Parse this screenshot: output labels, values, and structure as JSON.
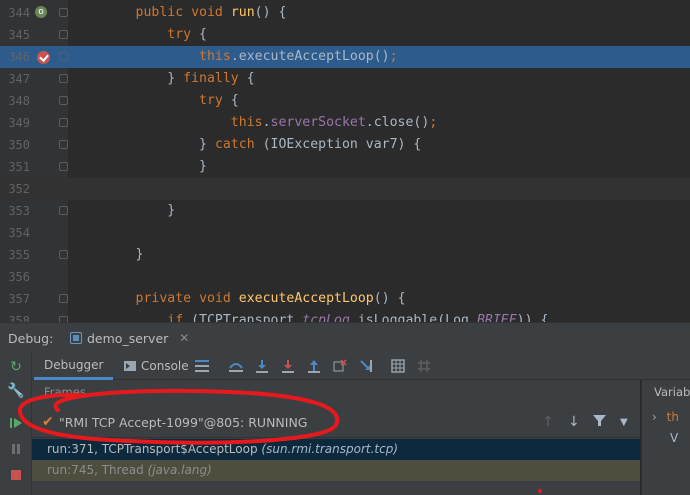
{
  "editor": {
    "lines": [
      {
        "num": "344",
        "tokens": [
          {
            "t": "        ",
            "c": "plain"
          },
          {
            "t": "public ",
            "c": "kw"
          },
          {
            "t": "void ",
            "c": "kw"
          },
          {
            "t": "run",
            "c": "fn"
          },
          {
            "t": "() {",
            "c": "plain"
          }
        ]
      },
      {
        "num": "345",
        "tokens": [
          {
            "t": "            ",
            "c": "plain"
          },
          {
            "t": "try ",
            "c": "kw"
          },
          {
            "t": "{",
            "c": "plain"
          }
        ]
      },
      {
        "num": "346",
        "tokens": [
          {
            "t": "                ",
            "c": "plain"
          },
          {
            "t": "this",
            "c": "kw"
          },
          {
            "t": ".executeAcceptLoop()",
            "c": "plain"
          },
          {
            "t": ";",
            "c": "kw"
          }
        ]
      },
      {
        "num": "347",
        "tokens": [
          {
            "t": "            ",
            "c": "plain"
          },
          {
            "t": "} ",
            "c": "plain"
          },
          {
            "t": "finally ",
            "c": "kw"
          },
          {
            "t": "{",
            "c": "plain"
          }
        ]
      },
      {
        "num": "348",
        "tokens": [
          {
            "t": "                ",
            "c": "plain"
          },
          {
            "t": "try ",
            "c": "kw"
          },
          {
            "t": "{",
            "c": "plain"
          }
        ]
      },
      {
        "num": "349",
        "tokens": [
          {
            "t": "                    ",
            "c": "plain"
          },
          {
            "t": "this",
            "c": "kw"
          },
          {
            "t": ".",
            "c": "plain"
          },
          {
            "t": "serverSocket",
            "c": "fld"
          },
          {
            "t": ".close()",
            "c": "plain"
          },
          {
            "t": ";",
            "c": "kw"
          }
        ]
      },
      {
        "num": "350",
        "tokens": [
          {
            "t": "                ",
            "c": "plain"
          },
          {
            "t": "} ",
            "c": "plain"
          },
          {
            "t": "catch ",
            "c": "kw"
          },
          {
            "t": "(IOException var7) {",
            "c": "plain"
          }
        ]
      },
      {
        "num": "351",
        "tokens": [
          {
            "t": "                ",
            "c": "plain"
          },
          {
            "t": "}",
            "c": "plain"
          }
        ]
      },
      {
        "num": "352",
        "tokens": []
      },
      {
        "num": "353",
        "tokens": [
          {
            "t": "            ",
            "c": "plain"
          },
          {
            "t": "}",
            "c": "plain"
          }
        ]
      },
      {
        "num": "354",
        "tokens": []
      },
      {
        "num": "355",
        "tokens": [
          {
            "t": "        ",
            "c": "plain"
          },
          {
            "t": "}",
            "c": "plain"
          }
        ]
      },
      {
        "num": "356",
        "tokens": []
      },
      {
        "num": "357",
        "tokens": [
          {
            "t": "        ",
            "c": "plain"
          },
          {
            "t": "private ",
            "c": "kw"
          },
          {
            "t": "void ",
            "c": "kw"
          },
          {
            "t": "executeAcceptLoop",
            "c": "fn"
          },
          {
            "t": "() {",
            "c": "plain"
          }
        ]
      },
      {
        "num": "358",
        "tokens": [
          {
            "t": "            ",
            "c": "plain"
          },
          {
            "t": "if ",
            "c": "kw"
          },
          {
            "t": "(TCPTransport.",
            "c": "plain"
          },
          {
            "t": "tcpLog",
            "c": "fld ital"
          },
          {
            "t": ".isLoggable(Log.",
            "c": "plain"
          },
          {
            "t": "BRIEF",
            "c": "fld ital"
          },
          {
            "t": ")) {",
            "c": "plain"
          }
        ]
      }
    ],
    "exec_line": "346",
    "current_line": "352",
    "breakpoint_line": "346",
    "override_line": "344"
  },
  "debug": {
    "label": "Debug:",
    "run_config": "demo_server",
    "tabs": {
      "debugger": "Debugger",
      "console": "Console"
    },
    "frames_title": "Frames",
    "variables_title": "Variabl",
    "thread": "\"RMI TCP Accept-1099\"@805: RUNNING",
    "frames": [
      {
        "method": "run:371, TCPTransport$AcceptLoop",
        "pkg": "(sun.rmi.transport.tcp)"
      },
      {
        "method": "run:745, Thread",
        "pkg": "(java.lang)"
      }
    ],
    "var_rows": [
      "th",
      "V"
    ]
  },
  "colors": {
    "exec_highlight": "#2d5b8c",
    "keyword": "#cc7832",
    "method": "#ffc66d",
    "field": "#9876aa",
    "annotation": "#e8191d"
  }
}
